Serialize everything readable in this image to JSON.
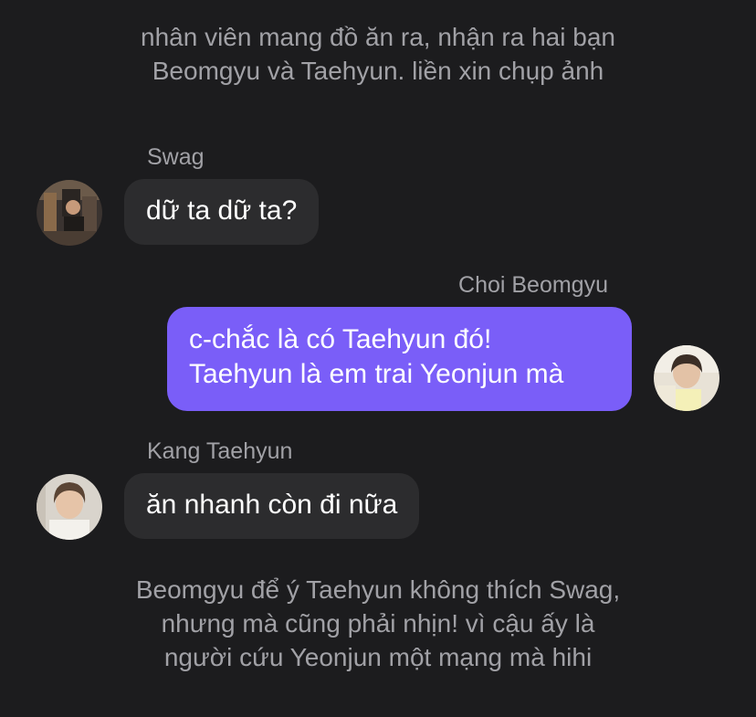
{
  "narration_top": [
    "nhân viên mang đồ ăn ra, nhận ra hai bạn",
    "Beomgyu và Taehyun. liền xin chụp ảnh"
  ],
  "messages": [
    {
      "sender": "Swag",
      "lines": [
        "dữ ta dữ ta?"
      ],
      "avatar_icon": "swag-avatar-photo"
    },
    {
      "sender": "Choi Beomgyu",
      "lines": [
        "c-chắc là có Taehyun đó!",
        "Taehyun là em trai Yeonjun mà"
      ],
      "avatar_icon": "beomgyu-avatar-photo"
    },
    {
      "sender": "Kang Taehyun",
      "lines": [
        "ăn nhanh còn đi nữa"
      ],
      "avatar_icon": "taehyun-avatar-photo"
    }
  ],
  "narration_bottom": [
    "Beomgyu để ý Taehyun không thích Swag,",
    "nhưng mà cũng phải nhịn! vì cậu ấy là",
    "người cứu Yeonjun một mạng mà hihi"
  ],
  "colors": {
    "background": "#1c1c1e",
    "incoming_bubble": "#2c2c2e",
    "outgoing_bubble": "#7a5ef8",
    "secondary_text": "#a1a1a6"
  }
}
